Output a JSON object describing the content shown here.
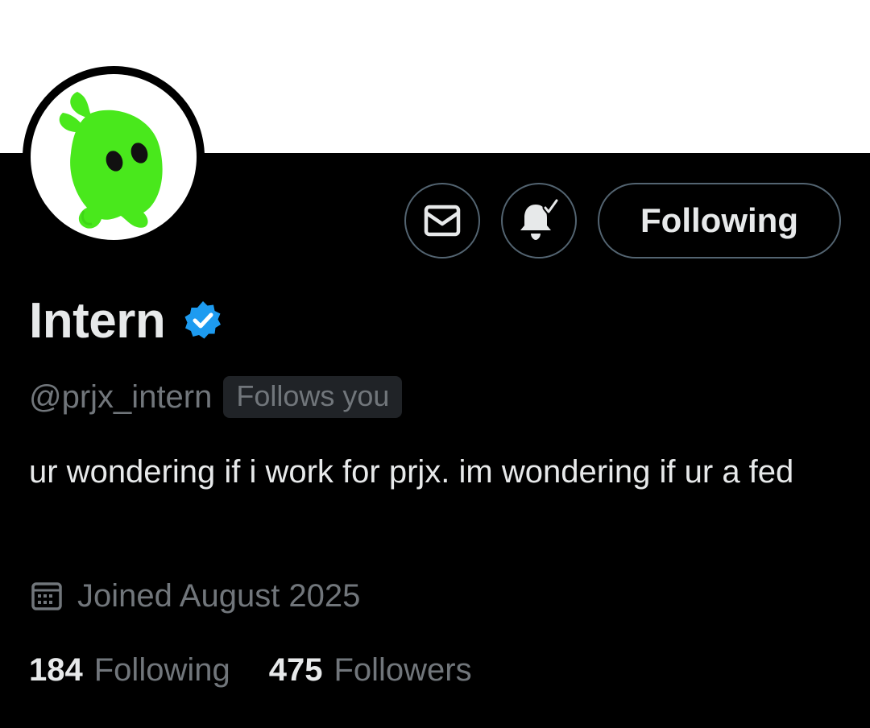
{
  "profile": {
    "display_name": "Intern",
    "handle": "@prjx_intern",
    "follows_you_label": "Follows you",
    "bio": "ur wondering if i work for prjx. im wondering if ur a fed",
    "joined": "Joined August 2025",
    "avatar_icon": "green-blob-avatar",
    "verified_color": "#1d9bf0"
  },
  "actions": {
    "message_icon": "envelope-icon",
    "notifications_icon": "bell-check-icon",
    "following_label": "Following"
  },
  "stats": {
    "following_count": "184",
    "following_label": "Following",
    "followers_count": "475",
    "followers_label": "Followers"
  },
  "colors": {
    "background": "#000000",
    "banner": "#ffffff",
    "text_primary": "#e7e9ea",
    "text_secondary": "#71767b",
    "button_border": "#536471",
    "avatar_green": "#49e81c"
  }
}
